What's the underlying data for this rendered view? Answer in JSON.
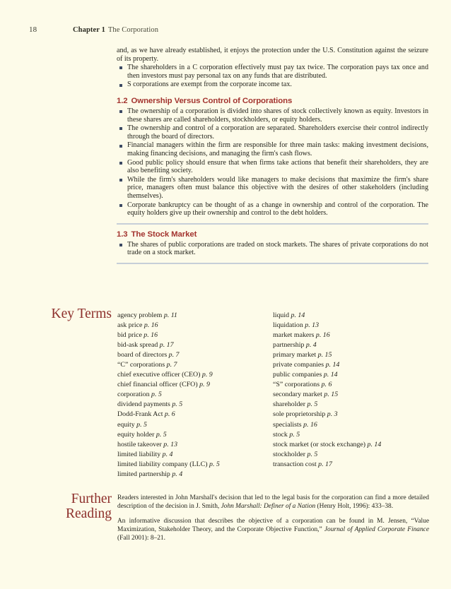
{
  "page": {
    "folio": "18",
    "chapter_label": "Chapter 1",
    "chapter_title": "The Corporation",
    "background_color": "#fdfbe9",
    "heading_color": "#a3342f",
    "side_label_color": "#8d2f2b",
    "bullet_color": "#3d4a63",
    "rule_color": "#c6cfd8"
  },
  "summary": {
    "continued_paragraph": "and, as we have already established, it enjoys the protection under the U.S. Constitution against the seizure of its property.",
    "continued_bullets": [
      "The shareholders in a C corporation effectively must pay tax twice. The corporation pays tax once and then investors must pay personal tax on any funds that are distributed.",
      "S corporations are exempt from the corporate income tax."
    ],
    "sections": [
      {
        "number": "1.2",
        "title": "Ownership Versus Control of Corporations",
        "bullets": [
          "The ownership of a corporation is divided into shares of stock collectively known as equity. Investors in these shares are called shareholders, stockholders, or equity holders.",
          "The ownership and control of a corporation are separated. Shareholders exercise their control indirectly through the board of directors.",
          "Financial managers within the firm are responsible for three main tasks: making investment decisions, making financing decisions, and managing the firm's cash flows.",
          "Good public policy should ensure that when firms take actions that benefit their shareholders, they are also benefiting society.",
          "While the firm's shareholders would like managers to make decisions that maximize the firm's share price, managers often must balance this objective with the desires of other stakeholders (including themselves).",
          "Corporate bankruptcy can be thought of as a change in ownership and control of the corporation. The equity holders give up their ownership and control to the debt holders."
        ]
      },
      {
        "number": "1.3",
        "title": "The Stock Market",
        "bullets": [
          "The shares of public corporations are traded on stock markets. The shares of private corporations do not trade on a stock market."
        ]
      }
    ]
  },
  "key_terms": {
    "label_line1": "Key Terms",
    "column1": [
      {
        "term": "agency problem",
        "page": "p. 11"
      },
      {
        "term": "ask price",
        "page": "p. 16"
      },
      {
        "term": "bid price",
        "page": "p. 16"
      },
      {
        "term": "bid-ask spread",
        "page": "p. 17"
      },
      {
        "term": "board of directors",
        "page": "p. 7"
      },
      {
        "term": "“C” corporations",
        "page": "p. 7"
      },
      {
        "term": "chief executive officer (CEO)",
        "page": "p. 9"
      },
      {
        "term": "chief financial officer (CFO)",
        "page": "p. 9"
      },
      {
        "term": "corporation",
        "page": "p. 5"
      },
      {
        "term": "dividend payments",
        "page": "p. 5"
      },
      {
        "term": "Dodd-Frank Act",
        "page": "p. 6"
      },
      {
        "term": "equity",
        "page": "p. 5"
      },
      {
        "term": "equity holder",
        "page": "p. 5"
      },
      {
        "term": "hostile takeover",
        "page": "p. 13"
      },
      {
        "term": "limited liability",
        "page": "p. 4"
      },
      {
        "term": "limited liability company (LLC)",
        "page": "p. 5"
      },
      {
        "term": "limited partnership",
        "page": "p. 4"
      }
    ],
    "column2": [
      {
        "term": "liquid",
        "page": "p. 14"
      },
      {
        "term": "liquidation",
        "page": "p. 13"
      },
      {
        "term": "market makers",
        "page": "p. 16"
      },
      {
        "term": "partnership",
        "page": "p. 4"
      },
      {
        "term": "primary market",
        "page": "p. 15"
      },
      {
        "term": "private companies",
        "page": "p. 14"
      },
      {
        "term": "public companies",
        "page": "p. 14"
      },
      {
        "term": "“S” corporations",
        "page": "p. 6"
      },
      {
        "term": "secondary market",
        "page": "p. 15"
      },
      {
        "term": "shareholder",
        "page": "p. 5"
      },
      {
        "term": "sole proprietorship",
        "page": "p. 3"
      },
      {
        "term": "specialists",
        "page": "p. 16"
      },
      {
        "term": "stock",
        "page": "p. 5"
      },
      {
        "term": "stock market (or stock exchange)",
        "page": "p. 14"
      },
      {
        "term": "stockholder",
        "page": "p. 5"
      },
      {
        "term": "transaction cost",
        "page": "p. 17"
      }
    ]
  },
  "further_reading": {
    "label_line1": "Further",
    "label_line2": "Reading",
    "paragraphs": [
      {
        "part1": "Readers interested in John Marshall's decision that led to the legal basis for the corporation can find a more detailed description of the decision in J. Smith, ",
        "italic": "John Marshall: Definer of a Nation",
        "part2": " (Henry Holt, 1996): 433–38."
      },
      {
        "part1": "An informative discussion that describes the objective of a corporation can be found in M. Jensen, “Value Maximization, Stakeholder Theory, and the Corporate Objective Function,” ",
        "italic": "Journal of Applied Corporate Finance",
        "part2": " (Fall 2001): 8–21."
      }
    ]
  }
}
